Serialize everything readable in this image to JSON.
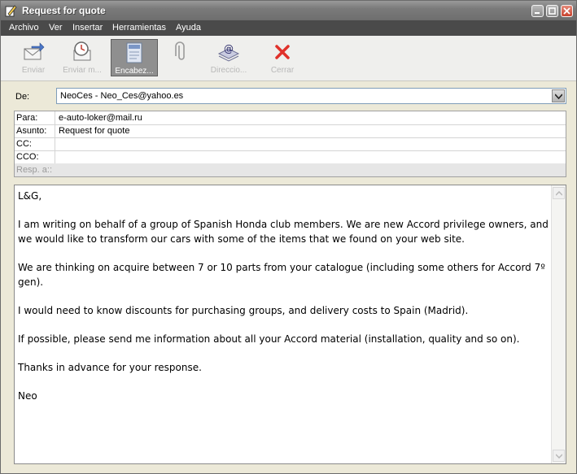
{
  "window": {
    "title": "Request for quote"
  },
  "menu": [
    "Archivo",
    "Ver",
    "Insertar",
    "Herramientas",
    "Ayuda"
  ],
  "toolbar": {
    "send": "Enviar",
    "send_later": "Enviar m...",
    "headers": "Encabez...",
    "attach": "",
    "address": "Direccio...",
    "close": "Cerrar"
  },
  "from": {
    "label": "De:",
    "value": "NeoCes - Neo_Ces@yahoo.es"
  },
  "fields": [
    {
      "label": "Para:",
      "value": "e-auto-loker@mail.ru"
    },
    {
      "label": "Asunto:",
      "value": "Request for quote"
    },
    {
      "label": "CC:",
      "value": ""
    },
    {
      "label": "CCO:",
      "value": ""
    },
    {
      "label": "Resp. a::",
      "value": ""
    }
  ],
  "body": [
    "L&G,",
    "I am writing on behalf of a group of Spanish Honda club members. We are new Accord privilege owners, and we would like to transform our cars with some of the items that we found on your web site.",
    "We are thinking on acquire between 7 or 10 parts from your catalogue (including some others for Accord 7º gen).",
    "I would need to know discounts for purchasing groups, and delivery costs to Spain (Madrid).",
    "If possible, please send me information about all your Accord material (installation, quality and so on).",
    "Thanks in advance for your response.",
    "Neo"
  ]
}
